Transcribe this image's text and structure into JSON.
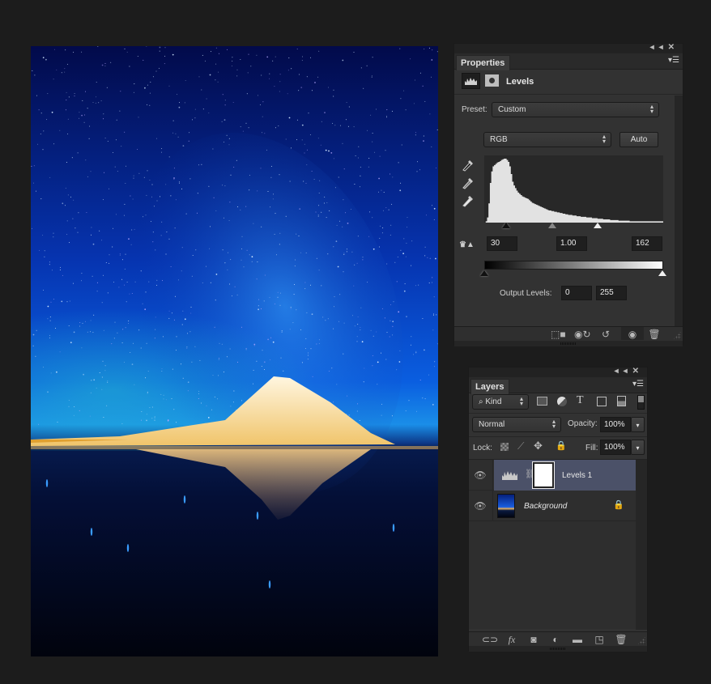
{
  "document": {
    "image_description": "Starry night sky with Milky Way over a snow-lit mountain reflected in water"
  },
  "properties_panel": {
    "tab": "Properties",
    "collapse_icon": "double-chevron-left-icon",
    "close_icon": "close-icon",
    "menu_icon": "panel-menu-icon",
    "adjustment_title": "Levels",
    "preset_label": "Preset:",
    "preset_value": "Custom",
    "channel_value": "RGB",
    "auto_label": "Auto",
    "histogram": {
      "values": [
        0,
        2,
        8,
        30,
        62,
        80,
        88,
        90,
        92,
        94,
        95,
        96,
        98,
        99,
        100,
        100,
        98,
        95,
        88,
        76,
        64,
        58,
        54,
        50,
        47,
        45,
        43,
        41,
        40,
        39,
        38,
        37,
        35,
        33,
        31,
        30,
        29,
        28,
        27,
        26,
        25,
        24,
        23,
        22,
        21,
        20,
        19,
        19,
        18,
        18,
        17,
        17,
        16,
        16,
        15,
        15,
        14,
        14,
        13,
        13,
        12,
        12,
        12,
        11,
        11,
        11,
        10,
        10,
        10,
        9,
        9,
        9,
        9,
        8,
        8,
        8,
        8,
        7,
        7,
        7,
        7,
        6,
        6,
        6,
        6,
        5,
        5,
        5,
        5,
        5,
        4,
        4,
        4,
        4,
        4,
        4,
        3,
        3,
        3,
        3,
        3,
        3,
        3,
        3,
        2,
        2,
        2,
        2,
        2,
        2,
        2,
        2,
        2,
        2,
        2,
        2,
        2,
        2,
        2,
        2,
        2,
        2,
        2,
        2,
        2,
        2,
        2,
        2
      ]
    },
    "input_black": "30",
    "input_gamma": "1.00",
    "input_white": "162",
    "output_label": "Output Levels:",
    "output_black": "0",
    "output_white": "255",
    "footer_icons": [
      "clip-to-layer-icon",
      "view-previous-state-icon",
      "reset-icon",
      "toggle-visibility-icon",
      "delete-icon"
    ]
  },
  "layers_panel": {
    "tab": "Layers",
    "filter_label": "Kind",
    "blend_mode": "Normal",
    "opacity_label": "Opacity:",
    "opacity_value": "100%",
    "lock_label": "Lock:",
    "fill_label": "Fill:",
    "fill_value": "100%",
    "layers": [
      {
        "name": "Levels 1",
        "type": "adjustment",
        "visible": true,
        "selected": true,
        "locked": false
      },
      {
        "name": "Background",
        "type": "image",
        "visible": true,
        "selected": false,
        "locked": true
      }
    ],
    "footer_icons": [
      "link-layers-icon",
      "fx-icon",
      "add-mask-icon",
      "new-adjustment-icon",
      "new-group-icon",
      "new-layer-icon",
      "delete-layer-icon"
    ]
  },
  "colors": {
    "background": "#1c1c1c",
    "panel": "#323232",
    "selected_layer": "#4b5168",
    "histogram_fill": "#e2e2e2"
  }
}
